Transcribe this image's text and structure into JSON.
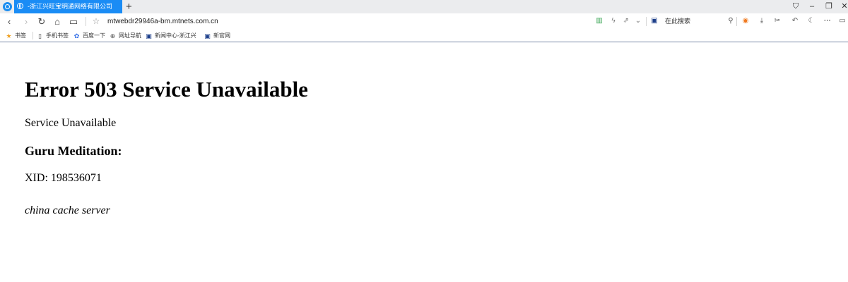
{
  "browser": {
    "tab_title": "-浙江兴旺宝明通网络有限公司",
    "tab_close": "×",
    "new_tab": "+",
    "window_controls": [
      "⛉",
      "–",
      "❐",
      "✕"
    ],
    "url": "mtwebdr29946a-bm.mtnets.com.cn",
    "search_placeholder": "在此搜索",
    "more_label": "···"
  },
  "bookmarks": [
    {
      "label": "书签",
      "icon": "star-icon",
      "glyph": "★",
      "color": "#f0a020"
    },
    {
      "label": "手机书签",
      "icon": "phone-icon",
      "glyph": "▯",
      "color": "#555555"
    },
    {
      "label": "百度一下",
      "icon": "baidu-paw-icon",
      "glyph": "✿",
      "color": "#2e6be6"
    },
    {
      "label": "网址导航",
      "icon": "globe-icon",
      "glyph": "⊕",
      "color": "#555555"
    },
    {
      "label": "新闻中心-浙江兴",
      "icon": "news-site-icon",
      "glyph": "▣",
      "color": "#1d3f8a"
    },
    {
      "label": "新官网",
      "icon": "news-site-icon",
      "glyph": "▣",
      "color": "#1d3f8a"
    }
  ],
  "page": {
    "heading": "Error 503 Service Unavailable",
    "message": "Service Unavailable",
    "subheading": "Guru Meditation:",
    "xid": "XID: 198536071",
    "footer": "china cache server"
  },
  "colors": {
    "tab_active": "#1a8cf5",
    "titlebar": "#ebecee",
    "bookmark_border": "#7a8aa8"
  }
}
